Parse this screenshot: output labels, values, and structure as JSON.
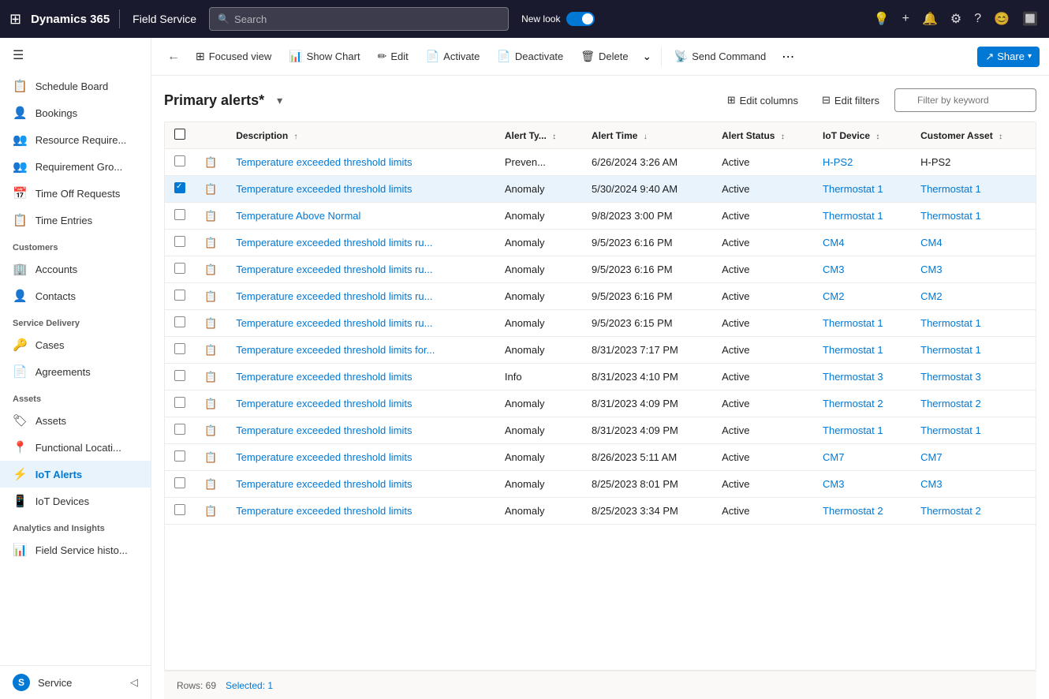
{
  "topNav": {
    "appIcon": "⊞",
    "brand": "Dynamics 365",
    "divider": true,
    "moduleName": "Field Service",
    "searchPlaceholder": "Search",
    "newLookLabel": "New look",
    "icons": [
      "💡",
      "+",
      "🔔",
      "⚙",
      "?",
      "😊",
      "🔲"
    ],
    "avatarInitial": "S"
  },
  "sidebar": {
    "hamburger": "☰",
    "items": [
      {
        "id": "schedule-board",
        "icon": "📋",
        "label": "Schedule Board"
      },
      {
        "id": "bookings",
        "icon": "👤",
        "label": "Bookings"
      },
      {
        "id": "resource-require",
        "icon": "👥",
        "label": "Resource Require..."
      },
      {
        "id": "requirement-gro",
        "icon": "👥",
        "label": "Requirement Gro..."
      },
      {
        "id": "time-off-requests",
        "icon": "📅",
        "label": "Time Off Requests"
      },
      {
        "id": "time-entries",
        "icon": "📋",
        "label": "Time Entries"
      }
    ],
    "sections": [
      {
        "title": "Customers",
        "items": [
          {
            "id": "accounts",
            "icon": "🏢",
            "label": "Accounts"
          },
          {
            "id": "contacts",
            "icon": "👤",
            "label": "Contacts"
          }
        ]
      },
      {
        "title": "Service Delivery",
        "items": [
          {
            "id": "cases",
            "icon": "🔑",
            "label": "Cases"
          },
          {
            "id": "agreements",
            "icon": "📄",
            "label": "Agreements"
          }
        ]
      },
      {
        "title": "Assets",
        "items": [
          {
            "id": "assets",
            "icon": "🏷",
            "label": "Assets"
          },
          {
            "id": "functional-locati",
            "icon": "📍",
            "label": "Functional Locati..."
          },
          {
            "id": "iot-alerts",
            "icon": "⚡",
            "label": "IoT Alerts",
            "active": true
          },
          {
            "id": "iot-devices",
            "icon": "📱",
            "label": "IoT Devices"
          }
        ]
      },
      {
        "title": "Analytics and Insights",
        "items": [
          {
            "id": "field-service-histo",
            "icon": "📊",
            "label": "Field Service histo..."
          }
        ]
      }
    ],
    "bottomItem": {
      "icon": "S",
      "label": "Service",
      "chevron": "◁"
    }
  },
  "toolbar": {
    "backLabel": "←",
    "buttons": [
      {
        "id": "focused-view",
        "icon": "⊞",
        "label": "Focused view"
      },
      {
        "id": "show-chart",
        "icon": "📊",
        "label": "Show Chart"
      },
      {
        "id": "edit",
        "icon": "✏",
        "label": "Edit"
      },
      {
        "id": "activate",
        "icon": "📄",
        "label": "Activate"
      },
      {
        "id": "deactivate",
        "icon": "📄",
        "label": "Deactivate"
      },
      {
        "id": "delete",
        "icon": "🗑",
        "label": "Delete"
      }
    ],
    "moreLabel": "⌄",
    "sendCommandLabel": "Send Command",
    "sendCommandIcon": "📡",
    "moreDotsLabel": "⋯",
    "shareLabel": "Share",
    "shareIcon": "↗"
  },
  "grid": {
    "title": "Primary alerts*",
    "editColumnsLabel": "Edit columns",
    "editFiltersLabel": "Edit filters",
    "filterPlaceholder": "Filter by keyword",
    "columns": [
      {
        "id": "checkbox",
        "label": ""
      },
      {
        "id": "icon",
        "label": ""
      },
      {
        "id": "description",
        "label": "Description",
        "sortable": true,
        "sorted": true,
        "dir": "↑"
      },
      {
        "id": "alert-type",
        "label": "Alert Ty...",
        "sortable": true
      },
      {
        "id": "alert-time",
        "label": "Alert Time",
        "sortable": true,
        "sorted": true,
        "dir": "↓"
      },
      {
        "id": "alert-status",
        "label": "Alert Status",
        "sortable": true
      },
      {
        "id": "iot-device",
        "label": "IoT Device",
        "sortable": true
      },
      {
        "id": "customer-asset",
        "label": "Customer Asset",
        "sortable": true
      }
    ],
    "rows": [
      {
        "id": 1,
        "selected": false,
        "description": "Temperature exceeded threshold limits",
        "alertType": "Preven...",
        "alertTime": "6/26/2024 3:26 AM",
        "alertStatus": "Active",
        "iotDevice": "H-PS2",
        "iotDeviceLink": true,
        "customerAsset": "H-PS2",
        "customerAssetLink": false
      },
      {
        "id": 2,
        "selected": true,
        "description": "Temperature exceeded threshold limits",
        "alertType": "Anomaly",
        "alertTime": "5/30/2024 9:40 AM",
        "alertStatus": "Active",
        "iotDevice": "Thermostat 1",
        "iotDeviceLink": true,
        "customerAsset": "Thermostat 1",
        "customerAssetLink": true
      },
      {
        "id": 3,
        "selected": false,
        "description": "Temperature Above Normal",
        "alertType": "Anomaly",
        "alertTime": "9/8/2023 3:00 PM",
        "alertStatus": "Active",
        "iotDevice": "Thermostat 1",
        "iotDeviceLink": true,
        "customerAsset": "Thermostat 1",
        "customerAssetLink": true
      },
      {
        "id": 4,
        "selected": false,
        "description": "Temperature exceeded threshold limits ru...",
        "alertType": "Anomaly",
        "alertTime": "9/5/2023 6:16 PM",
        "alertStatus": "Active",
        "iotDevice": "CM4",
        "iotDeviceLink": true,
        "customerAsset": "CM4",
        "customerAssetLink": true
      },
      {
        "id": 5,
        "selected": false,
        "description": "Temperature exceeded threshold limits ru...",
        "alertType": "Anomaly",
        "alertTime": "9/5/2023 6:16 PM",
        "alertStatus": "Active",
        "iotDevice": "CM3",
        "iotDeviceLink": true,
        "customerAsset": "CM3",
        "customerAssetLink": true
      },
      {
        "id": 6,
        "selected": false,
        "description": "Temperature exceeded threshold limits ru...",
        "alertType": "Anomaly",
        "alertTime": "9/5/2023 6:16 PM",
        "alertStatus": "Active",
        "iotDevice": "CM2",
        "iotDeviceLink": true,
        "customerAsset": "CM2",
        "customerAssetLink": true
      },
      {
        "id": 7,
        "selected": false,
        "description": "Temperature exceeded threshold limits ru...",
        "alertType": "Anomaly",
        "alertTime": "9/5/2023 6:15 PM",
        "alertStatus": "Active",
        "iotDevice": "Thermostat 1",
        "iotDeviceLink": true,
        "customerAsset": "Thermostat 1",
        "customerAssetLink": true
      },
      {
        "id": 8,
        "selected": false,
        "description": "Temperature exceeded threshold limits for...",
        "alertType": "Anomaly",
        "alertTime": "8/31/2023 7:17 PM",
        "alertStatus": "Active",
        "iotDevice": "Thermostat 1",
        "iotDeviceLink": true,
        "customerAsset": "Thermostat 1",
        "customerAssetLink": true
      },
      {
        "id": 9,
        "selected": false,
        "description": "Temperature exceeded threshold limits",
        "alertType": "Info",
        "alertTime": "8/31/2023 4:10 PM",
        "alertStatus": "Active",
        "iotDevice": "Thermostat 3",
        "iotDeviceLink": true,
        "customerAsset": "Thermostat 3",
        "customerAssetLink": true
      },
      {
        "id": 10,
        "selected": false,
        "description": "Temperature exceeded threshold limits",
        "alertType": "Anomaly",
        "alertTime": "8/31/2023 4:09 PM",
        "alertStatus": "Active",
        "iotDevice": "Thermostat 2",
        "iotDeviceLink": true,
        "customerAsset": "Thermostat 2",
        "customerAssetLink": true
      },
      {
        "id": 11,
        "selected": false,
        "description": "Temperature exceeded threshold limits",
        "alertType": "Anomaly",
        "alertTime": "8/31/2023 4:09 PM",
        "alertStatus": "Active",
        "iotDevice": "Thermostat 1",
        "iotDeviceLink": true,
        "customerAsset": "Thermostat 1",
        "customerAssetLink": true
      },
      {
        "id": 12,
        "selected": false,
        "description": "Temperature exceeded threshold limits",
        "alertType": "Anomaly",
        "alertTime": "8/26/2023 5:11 AM",
        "alertStatus": "Active",
        "iotDevice": "CM7",
        "iotDeviceLink": true,
        "customerAsset": "CM7",
        "customerAssetLink": true
      },
      {
        "id": 13,
        "selected": false,
        "description": "Temperature exceeded threshold limits",
        "alertType": "Anomaly",
        "alertTime": "8/25/2023 8:01 PM",
        "alertStatus": "Active",
        "iotDevice": "CM3",
        "iotDeviceLink": true,
        "customerAsset": "CM3",
        "customerAssetLink": true
      },
      {
        "id": 14,
        "selected": false,
        "description": "Temperature exceeded threshold limits",
        "alertType": "Anomaly",
        "alertTime": "8/25/2023 3:34 PM",
        "alertStatus": "Active",
        "iotDevice": "Thermostat 2",
        "iotDeviceLink": true,
        "customerAsset": "Thermostat 2",
        "customerAssetLink": true
      }
    ],
    "statusBar": {
      "rowsLabel": "Rows: 69",
      "selectedLabel": "Selected: 1"
    }
  }
}
